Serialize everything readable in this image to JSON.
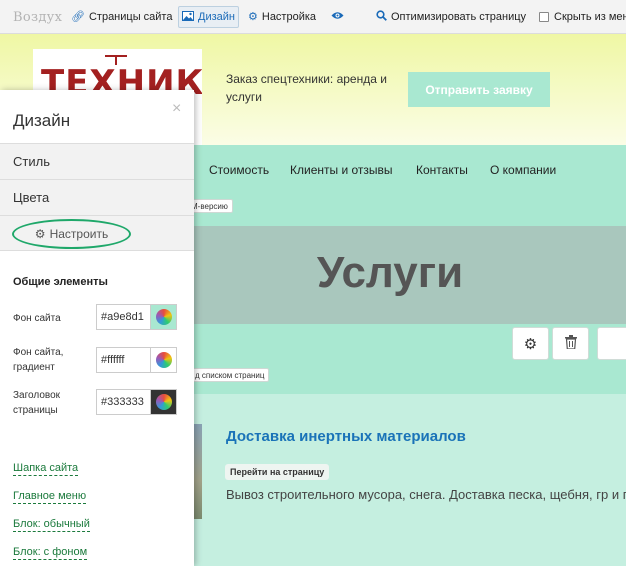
{
  "toolbar": {
    "brand": "Воздух",
    "pages": "Страницы сайта",
    "design": "Дизайн",
    "settings": "Настройка",
    "optimize": "Оптимизировать страницу",
    "hide_menu": "Скрыть из меню"
  },
  "header": {
    "logo_text": "ТЕХНИКА",
    "tagline": "Заказ спецтехники: аренда и услуги",
    "cta": "Отправить заявку"
  },
  "nav": {
    "items": [
      "Стоимость",
      "Клиенты и отзывы",
      "Контакты",
      "О компании"
    ],
    "mversion_tag": "М-версию"
  },
  "page": {
    "title": "Услуги",
    "pages_list_tag": "д списком страниц"
  },
  "service": {
    "title": "Доставка инертных материалов",
    "go_label": "Перейти на страницу",
    "description": "Вывоз строительного мусора, снега. Доставка песка, щебня, гр и пр."
  },
  "panel": {
    "title": "Дизайн",
    "close": "×",
    "style_label": "Стиль",
    "colors_label": "Цвета",
    "customize_label": "Настроить",
    "section_label": "Общие элементы",
    "fields": [
      {
        "label": "Фон сайта",
        "value": "#a9e8d1",
        "swatch": "#a9e8d1"
      },
      {
        "label": "Фон сайта, градиент",
        "value": "#ffffff",
        "swatch": "#ffffff"
      },
      {
        "label": "Заголовок страницы",
        "value": "#333333",
        "swatch": "#333333"
      }
    ],
    "links": [
      "Шапка сайта",
      "Главное меню",
      "Блок: обычный",
      "Блок: с фоном"
    ]
  },
  "icons": {
    "pages": "link-icon",
    "design": "image-icon",
    "settings": "gear-icon",
    "view": "eye-icon",
    "optimize": "search-icon",
    "block_settings": "gear-icon",
    "block_delete": "trash-icon",
    "customize": "gear-icon",
    "close": "close-icon"
  },
  "colors": {
    "site_bg": "#a9e8d1",
    "link_blue": "#1a73b8",
    "logo_red": "#a32020",
    "customize_ring": "#1fa86a"
  }
}
